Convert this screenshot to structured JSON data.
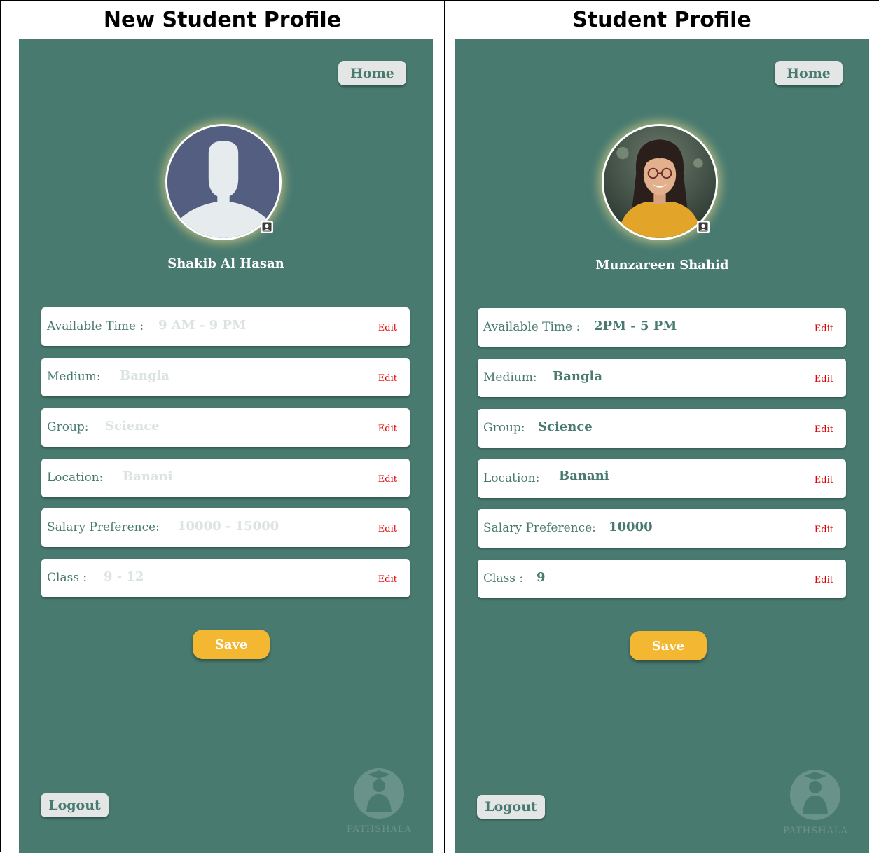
{
  "screens": [
    {
      "heading": "New Student Profile",
      "home_label": "Home",
      "student_name": "Shakib Al Hasan",
      "avatar_type": "placeholder-silhouette",
      "fields": [
        {
          "label": "Available Time :",
          "value": "9 AM - 9 PM",
          "edit": "Edit"
        },
        {
          "label": "Medium:",
          "value": "Bangla",
          "edit": "Edit"
        },
        {
          "label": "Group:",
          "value": "Science",
          "edit": "Edit"
        },
        {
          "label": "Location:",
          "value": "Banani",
          "edit": "Edit"
        },
        {
          "label": "Salary Preference:",
          "value": "10000 - 15000",
          "edit": "Edit"
        },
        {
          "label": "Class :",
          "value": "9 - 12",
          "edit": "Edit"
        }
      ],
      "save_label": "Save",
      "logout_label": "Logout",
      "logo_text": "PATHSHALA"
    },
    {
      "heading": "Student Profile",
      "home_label": "Home",
      "student_name": "Munzareen Shahid",
      "avatar_type": "photo",
      "fields": [
        {
          "label": "Available Time :",
          "value": "2PM - 5 PM",
          "edit": "Edit"
        },
        {
          "label": "Medium:",
          "value": "Bangla",
          "edit": "Edit"
        },
        {
          "label": "Group:",
          "value": "Science",
          "edit": "Edit"
        },
        {
          "label": "Location:",
          "value": "Banani",
          "edit": "Edit"
        },
        {
          "label": "Salary Preference:",
          "value": "10000",
          "edit": "Edit"
        },
        {
          "label": "Class :",
          "value": "9",
          "edit": "Edit"
        }
      ],
      "save_label": "Save",
      "logout_label": "Logout",
      "logo_text": "PATHSHALA"
    }
  ],
  "colors": {
    "screen_bg": "#487a70",
    "accent_yellow": "#f4b731",
    "edit_red": "#e00000",
    "button_grey": "#e4e6e6",
    "placeholder_text": "#dce4e2"
  }
}
